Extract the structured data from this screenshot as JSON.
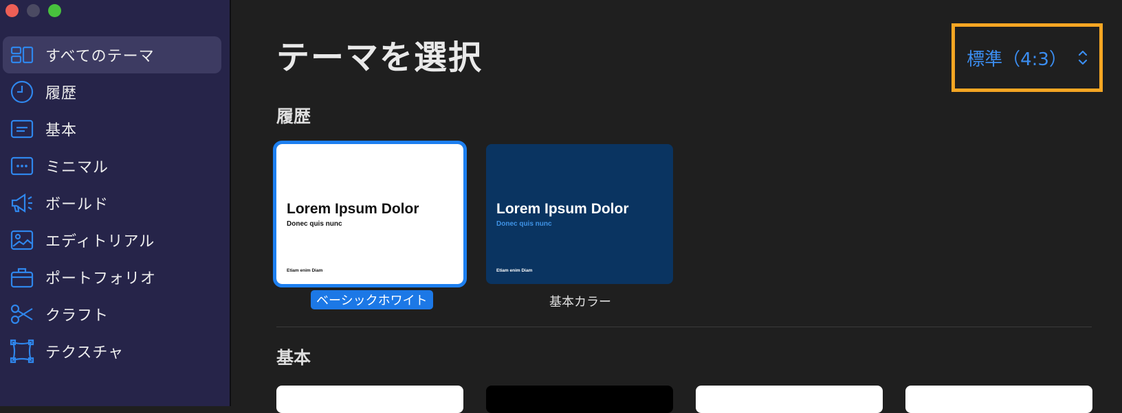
{
  "sidebar": {
    "items": [
      {
        "label": "すべてのテーマ",
        "icon": "all-themes-icon"
      },
      {
        "label": "履歴",
        "icon": "clock-icon"
      },
      {
        "label": "基本",
        "icon": "basic-icon"
      },
      {
        "label": "ミニマル",
        "icon": "minimal-icon"
      },
      {
        "label": "ボールド",
        "icon": "megaphone-icon"
      },
      {
        "label": "エディトリアル",
        "icon": "image-icon"
      },
      {
        "label": "ポートフォリオ",
        "icon": "briefcase-icon"
      },
      {
        "label": "クラフト",
        "icon": "scissors-icon"
      },
      {
        "label": "テクスチャ",
        "icon": "texture-icon"
      }
    ]
  },
  "main": {
    "title": "テーマを選択",
    "size_select": {
      "value": "標準（4:3）"
    },
    "recent": {
      "title": "履歴",
      "themes": [
        {
          "name": "ベーシックホワイト",
          "preview_title": "Lorem Ipsum Dolor",
          "preview_sub": "Donec quis nunc",
          "preview_foot": "Etiam enim Diam"
        },
        {
          "name": "基本カラー",
          "preview_title": "Lorem Ipsum Dolor",
          "preview_sub": "Donec quis nunc",
          "preview_foot": "Etiam enim Diam"
        }
      ]
    },
    "basic": {
      "title": "基本"
    }
  },
  "colors": {
    "accent": "#1d7ff0",
    "highlight_box": "#f5a623",
    "sidebar_bg": "#262449",
    "main_bg": "#1f1f1f"
  }
}
